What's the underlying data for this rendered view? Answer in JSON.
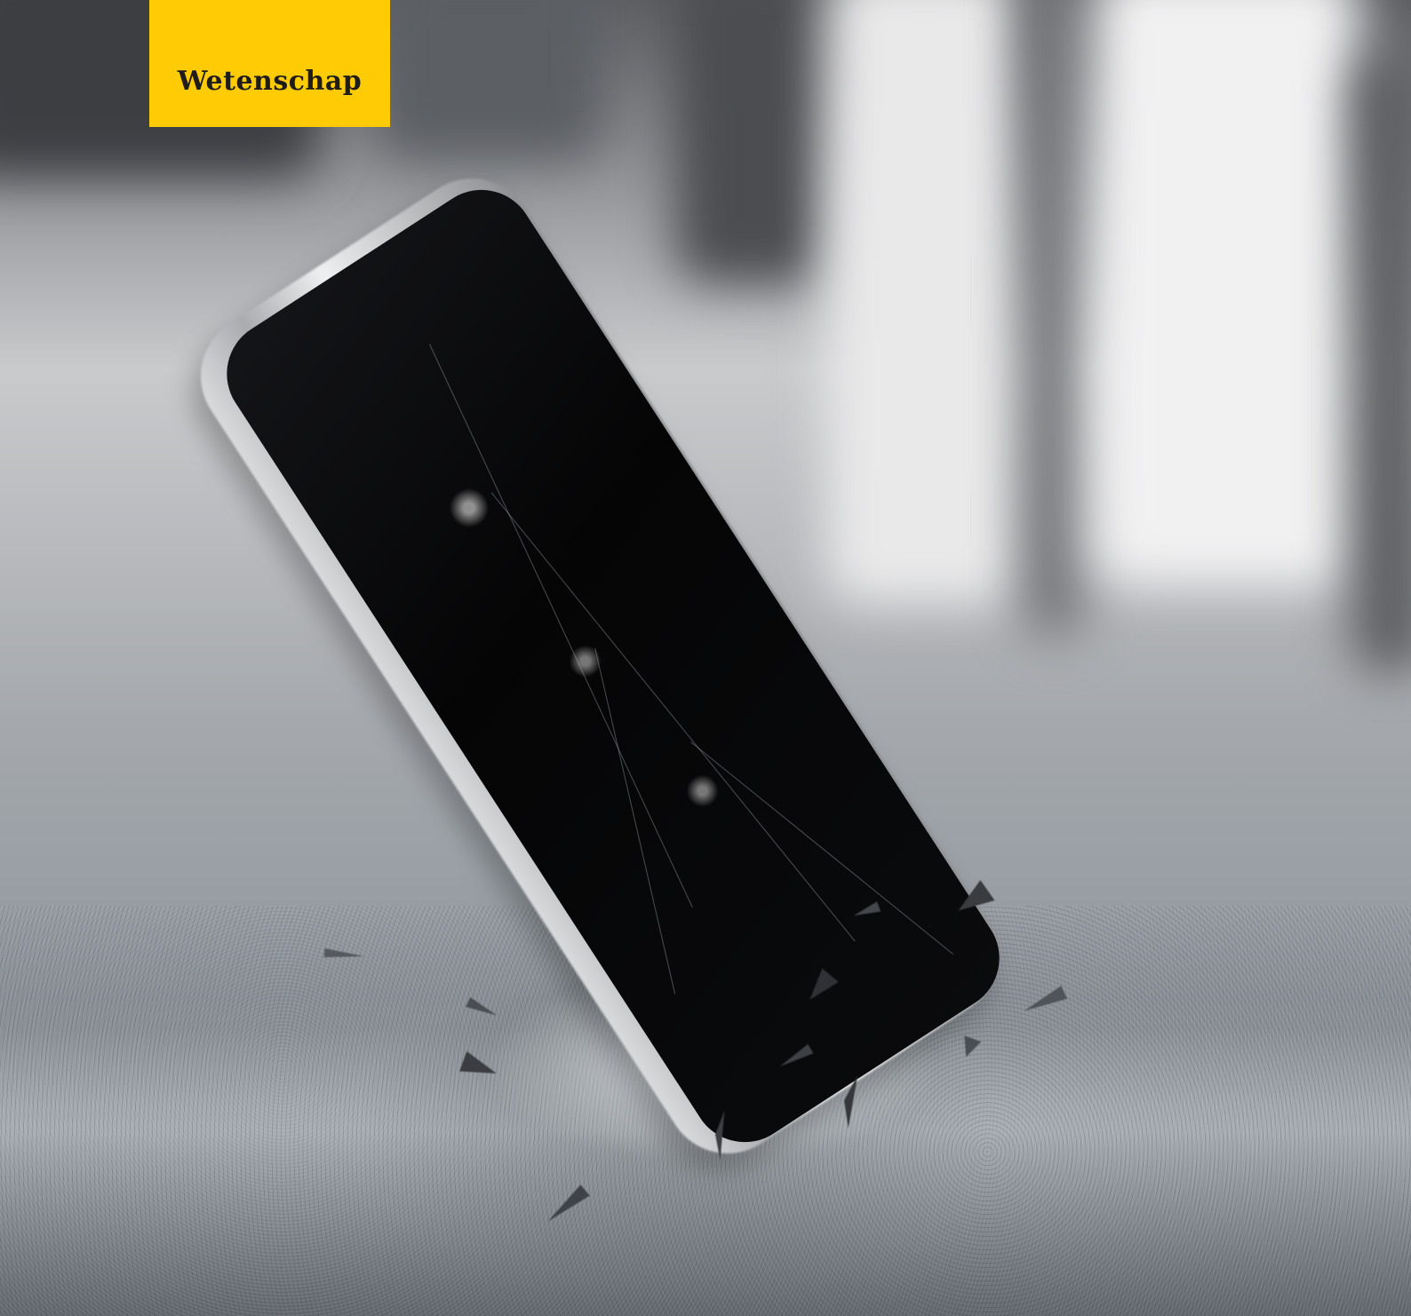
{
  "category": {
    "label": "Wetenschap",
    "color": "#ffcb05"
  },
  "photo": {
    "subject_icon": "phone-icon"
  }
}
